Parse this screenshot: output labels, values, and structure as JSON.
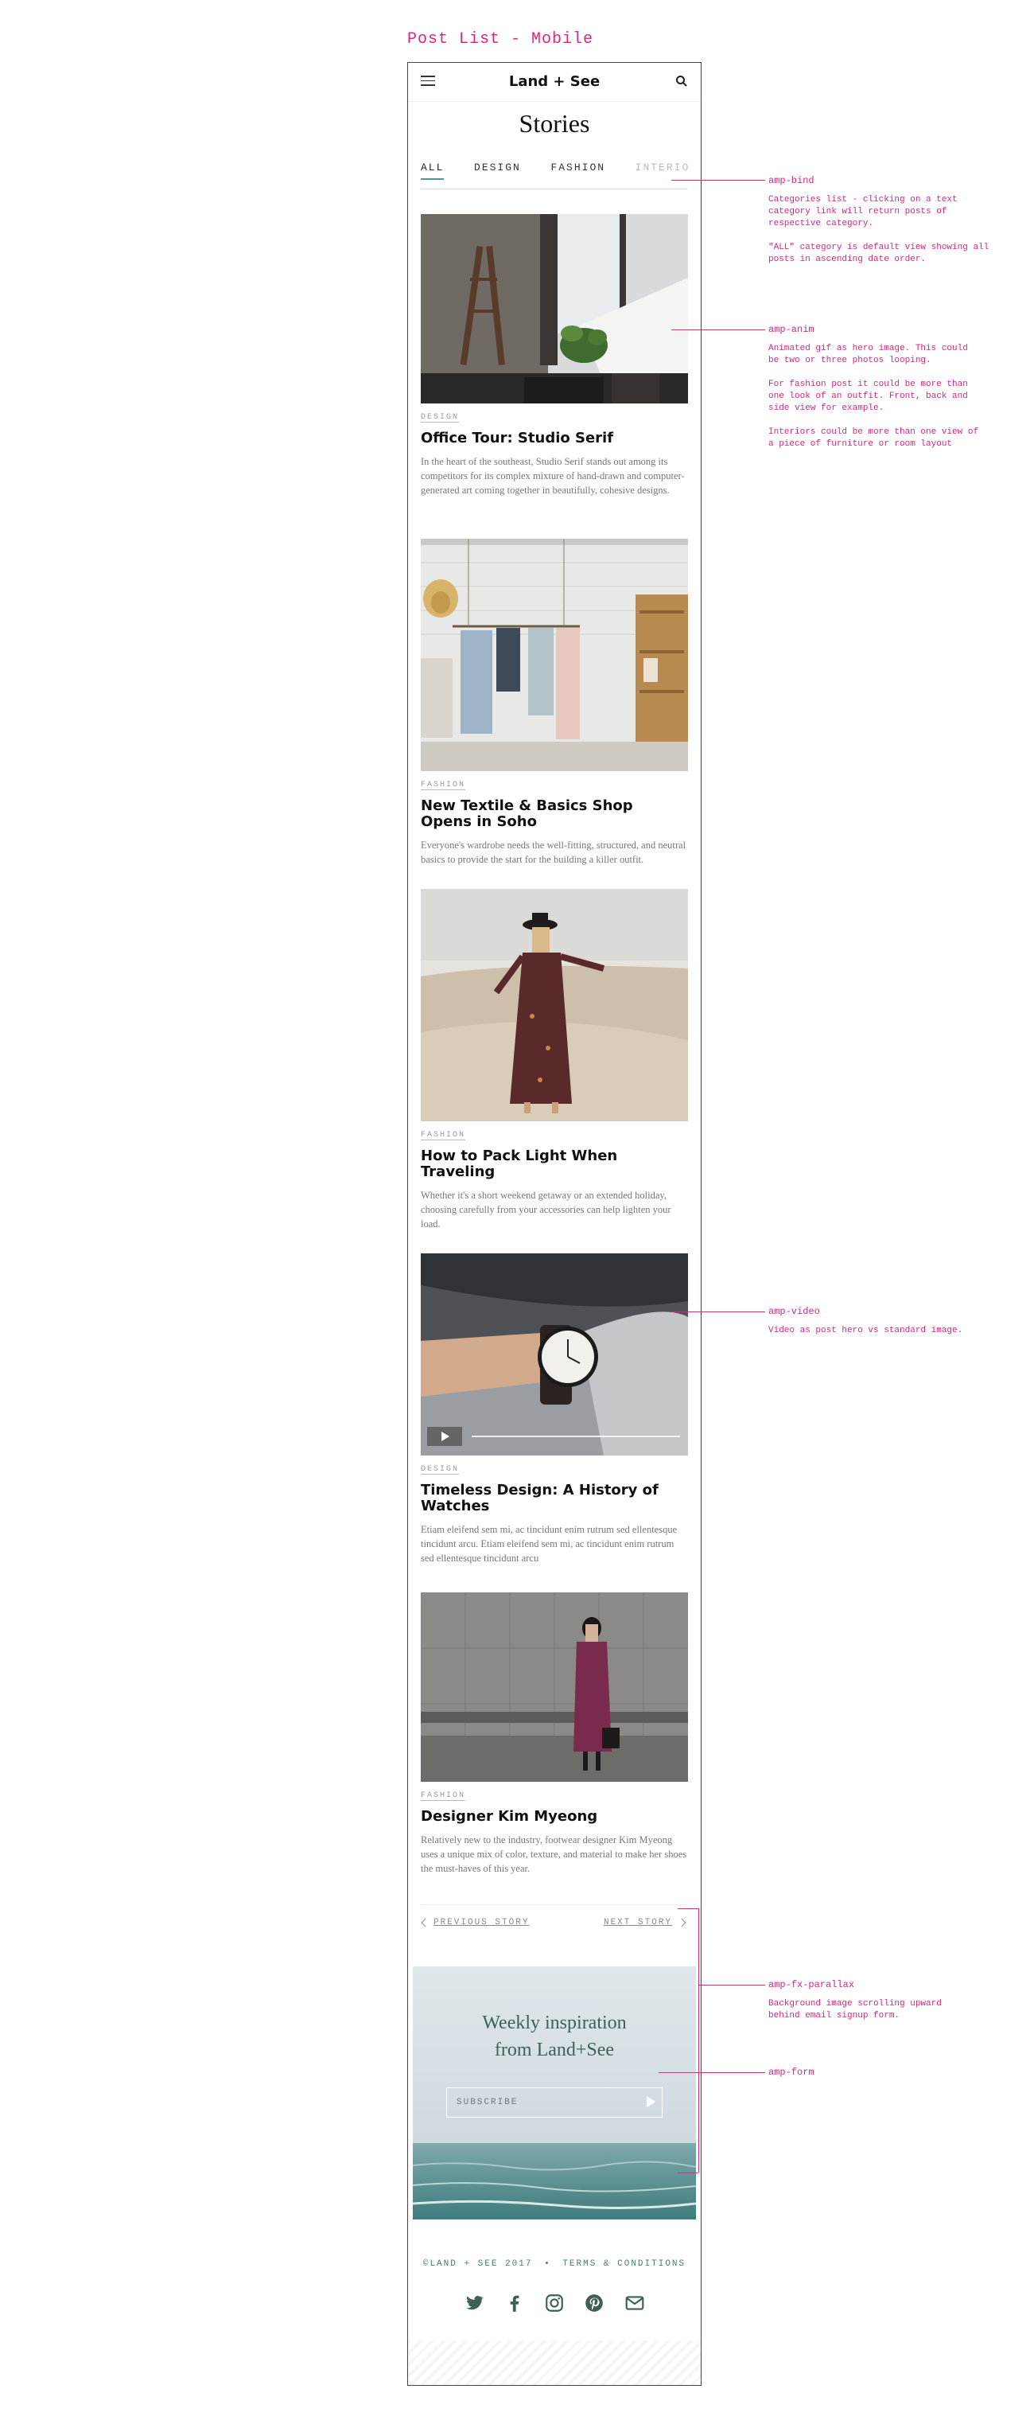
{
  "page_heading": "Post List - Mobile",
  "header": {
    "brand": "Land + See"
  },
  "stories_title": "Stories",
  "tabs": [
    {
      "label": "ALL",
      "active": true
    },
    {
      "label": "DESIGN"
    },
    {
      "label": "FASHION"
    },
    {
      "label": "INTERIORS"
    }
  ],
  "posts": [
    {
      "category": "DESIGN",
      "title": "Office Tour: Studio Serif",
      "excerpt": "In the heart of the southeast, Studio Serif stands out among its competitors for its complex mixture of hand-drawn and computer-generated art coming together in beautifully, cohesive designs."
    },
    {
      "category": "FASHION",
      "title": "New Textile & Basics Shop Opens in Soho",
      "excerpt": "Everyone's wardrobe needs the well-fitting, structured, and neutral basics to provide the start for the building a killer outfit."
    },
    {
      "category": "FASHION",
      "title": "How to Pack Light When Traveling",
      "excerpt": "Whether it's a short weekend getaway or an extended holiday, choosing carefully from your accessories can help lighten your load."
    },
    {
      "category": "DESIGN",
      "title": "Timeless Design: A History of Watches",
      "excerpt": "Etiam eleifend sem mi, ac tincidunt enim rutrum sed ellentesque tincidunt arcu. Etiam eleifend sem mi, ac tincidunt enim rutrum sed ellentesque tincidunt arcu"
    },
    {
      "category": "FASHION",
      "title": "Designer Kim Myeong",
      "excerpt": "Relatively new to the industry, footwear designer Kim Myeong uses a unique mix of color, texture, and material to make her shoes the must-haves of this year."
    }
  ],
  "pager": {
    "previous": "PREVIOUS STORY",
    "next": "NEXT STORY"
  },
  "promo": {
    "line1": "Weekly inspiration",
    "line2": "from Land+See",
    "input_placeholder": "SUBSCRIBE"
  },
  "footer": {
    "copyright": "©LAND + SEE 2017",
    "separator": "•",
    "terms": "TERMS & CONDITIONS"
  },
  "socials": [
    "twitter-icon",
    "facebook-icon",
    "instagram-icon",
    "pinterest-icon",
    "email-icon"
  ],
  "annotations": {
    "bind": {
      "label": "amp-bind",
      "text": "Categories list - clicking on a text\ncategory link will return posts of\nrespective category.\n\n\"ALL\" category is default view showing all\nposts in ascending date order."
    },
    "anim": {
      "label": "amp-anim",
      "text": "Animated gif as hero image. This could\nbe two or three photos looping.\n\nFor fashion post it could be more than\none look of an outfit. Front, back and\nside view for example.\n\nInteriors could be more than one view of\na piece of furniture or room layout"
    },
    "video": {
      "label": "amp-video",
      "text": "Video as post hero vs standard image."
    },
    "parallax": {
      "label": "amp-fx-parallax",
      "text": "Background image scrolling upward\nbehind email signup form."
    },
    "form": {
      "label": "amp-form"
    }
  },
  "colors": {
    "annotation": "#e0237e",
    "accent": "#4a9b8f",
    "promo_text": "#3d6157"
  }
}
